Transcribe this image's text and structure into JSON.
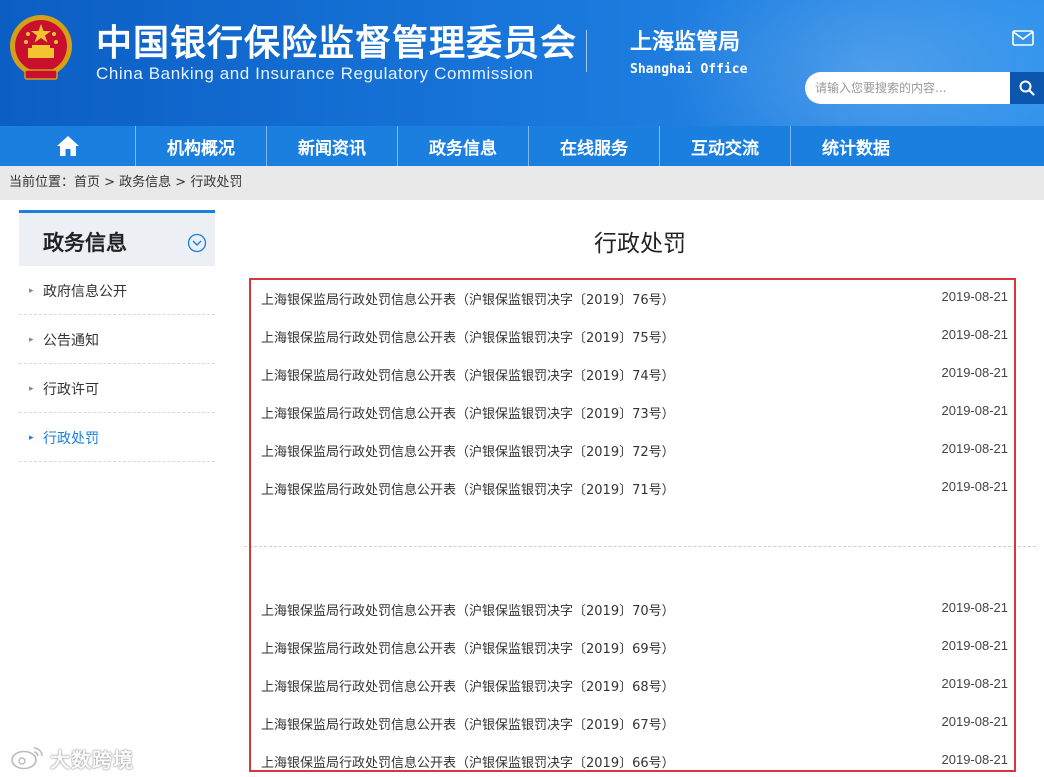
{
  "header": {
    "title_cn": "中国银行保险监督管理委员会",
    "title_en": "China Banking and Insurance Regulatory Commission",
    "office_cn": "上海监管局",
    "office_en": "Shanghai Office",
    "search_placeholder": "请输入您要搜索的内容...",
    "icons": {
      "emblem": "national-emblem-icon",
      "mail": "mail-icon",
      "search": "search-icon"
    },
    "colors": {
      "brand_blue": "#1b7fe0",
      "highlight_red": "#d9363e"
    }
  },
  "nav": {
    "home_icon": "home-icon",
    "items": [
      "机构概况",
      "新闻资讯",
      "政务信息",
      "在线服务",
      "互动交流",
      "统计数据"
    ]
  },
  "breadcrumb": {
    "text": "当前位置：首页 > 政务信息 > 行政处罚"
  },
  "sidebar": {
    "title": "政务信息",
    "items": [
      {
        "label": "政府信息公开",
        "active": false
      },
      {
        "label": "公告通知",
        "active": false
      },
      {
        "label": "行政许可",
        "active": false
      },
      {
        "label": "行政处罚",
        "active": true
      }
    ]
  },
  "main": {
    "title": "行政处罚",
    "items": [
      {
        "title": "上海银保监局行政处罚信息公开表（沪银保监银罚决字〔2019〕76号）",
        "date": "2019-08-21"
      },
      {
        "title": "上海银保监局行政处罚信息公开表（沪银保监银罚决字〔2019〕75号）",
        "date": "2019-08-21"
      },
      {
        "title": "上海银保监局行政处罚信息公开表（沪银保监银罚决字〔2019〕74号）",
        "date": "2019-08-21"
      },
      {
        "title": "上海银保监局行政处罚信息公开表（沪银保监银罚决字〔2019〕73号）",
        "date": "2019-08-21"
      },
      {
        "title": "上海银保监局行政处罚信息公开表（沪银保监银罚决字〔2019〕72号）",
        "date": "2019-08-21"
      },
      {
        "title": "上海银保监局行政处罚信息公开表（沪银保监银罚决字〔2019〕71号）",
        "date": "2019-08-21"
      },
      {
        "title": "上海银保监局行政处罚信息公开表（沪银保监银罚决字〔2019〕70号）",
        "date": "2019-08-21"
      },
      {
        "title": "上海银保监局行政处罚信息公开表（沪银保监银罚决字〔2019〕69号）",
        "date": "2019-08-21"
      },
      {
        "title": "上海银保监局行政处罚信息公开表（沪银保监银罚决字〔2019〕68号）",
        "date": "2019-08-21"
      },
      {
        "title": "上海银保监局行政处罚信息公开表（沪银保监银罚决字〔2019〕67号）",
        "date": "2019-08-21"
      },
      {
        "title": "上海银保监局行政处罚信息公开表（沪银保监银罚决字〔2019〕66号）",
        "date": "2019-08-21"
      }
    ]
  },
  "watermark": {
    "text": "大数跨境",
    "icon": "weibo-icon"
  }
}
